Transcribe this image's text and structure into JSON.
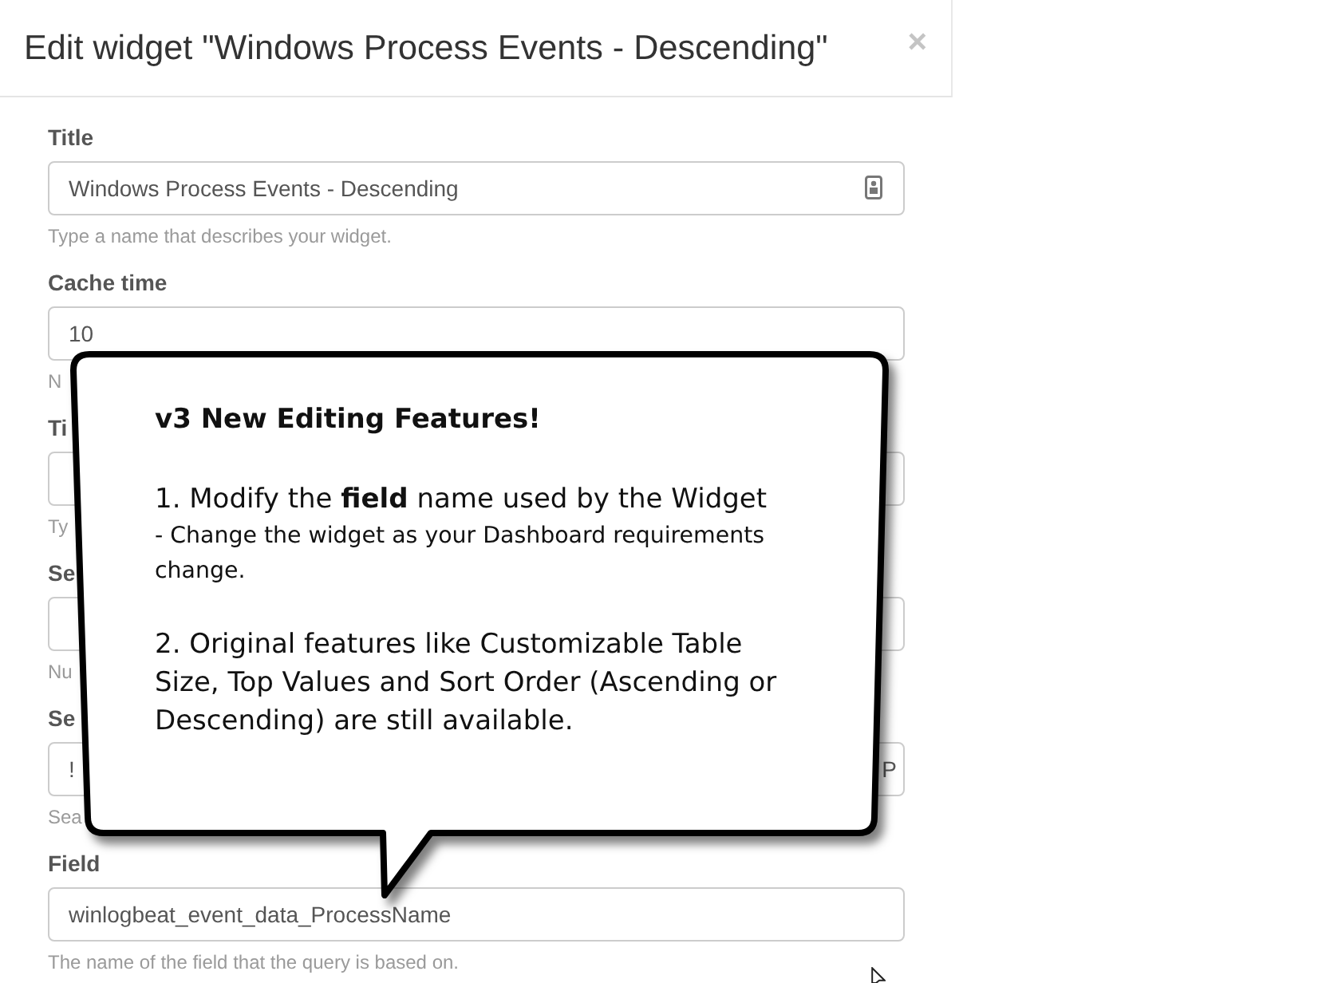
{
  "dialog": {
    "title": "Edit widget \"Windows Process Events - Descending\"",
    "close": "×"
  },
  "fields": [
    {
      "label": "Title",
      "value": "Windows Process Events - Descending",
      "help": "Type a name that describes your widget.",
      "autofill_icon": true
    },
    {
      "label": "Cache time",
      "value": "10",
      "help": "N"
    },
    {
      "label": "Ti",
      "help": "Ty"
    },
    {
      "label": "Se",
      "help": "Nu"
    },
    {
      "label": "Se",
      "value": "!",
      "value_end": "P",
      "help": "Sea"
    },
    {
      "label": "Field",
      "value": "winlogbeat_event_data_ProcessName",
      "help": "The name of the field that the query is based on."
    }
  ],
  "callout": {
    "title": "v3 New Editing Features!",
    "points": [
      {
        "text": "1. Modify the **field** name used by the Widget",
        "note": "- Change the widget as your Dashboard requirements change."
      },
      {
        "text": "2. Original features like Customizable Table Size, Top Values and Sort Order (Ascending or Descending) are still available."
      }
    ]
  }
}
